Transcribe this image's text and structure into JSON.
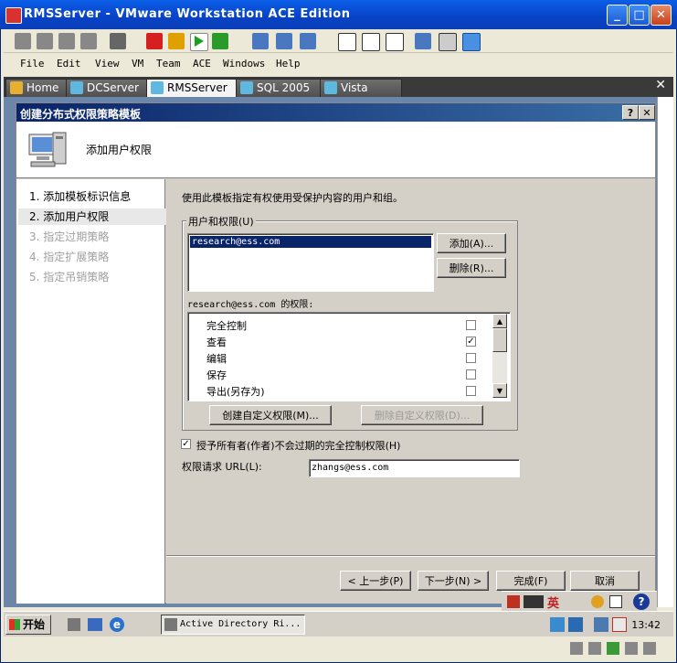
{
  "window": {
    "title": "RMSServer - VMware Workstation ACE Edition"
  },
  "menubar": [
    "File",
    "Edit",
    "View",
    "VM",
    "Team",
    "ACE",
    "Windows",
    "Help"
  ],
  "tabs": [
    {
      "label": "Home",
      "active": false
    },
    {
      "label": "DCServer",
      "active": false
    },
    {
      "label": "RMSServer",
      "active": true
    },
    {
      "label": "SQL 2005",
      "active": false
    },
    {
      "label": "Vista",
      "active": false
    }
  ],
  "dialog": {
    "title": "创建分布式权限策略模板",
    "header": "添加用户权限",
    "steps": [
      {
        "label": "1. 添加模板标识信息",
        "state": "done"
      },
      {
        "label": "2. 添加用户权限",
        "state": "current"
      },
      {
        "label": "3. 指定过期策略",
        "state": "disabled"
      },
      {
        "label": "4. 指定扩展策略",
        "state": "disabled"
      },
      {
        "label": "5. 指定吊销策略",
        "state": "disabled"
      }
    ],
    "intro": "使用此模板指定有权使用受保护内容的用户和组。",
    "users_group_label": "用户和权限(U)",
    "users": [
      "research@ess.com"
    ],
    "add_button": "添加(A)...",
    "remove_button": "删除(R)...",
    "perms_label": "research@ess.com 的权限:",
    "permissions": [
      {
        "label": "完全控制",
        "checked": false
      },
      {
        "label": "查看",
        "checked": true
      },
      {
        "label": "编辑",
        "checked": false
      },
      {
        "label": "保存",
        "checked": false
      },
      {
        "label": "导出(另存为)",
        "checked": false
      }
    ],
    "create_custom_button": "创建自定义权限(M)...",
    "delete_custom_button": "删除自定义权限(D)...",
    "grant_owner_checked": true,
    "grant_owner_label": "授予所有者(作者)不会过期的完全控制权限(H)",
    "url_label": "权限请求 URL(L):",
    "url_value": "zhangs@ess.com",
    "prev_button": "< 上一步(P)",
    "next_button": "下一步(N) >",
    "finish_button": "完成(F)",
    "cancel_button": "取消"
  },
  "ime": {
    "lang": "英"
  },
  "taskbar": {
    "start": "开始",
    "item": "Active Directory Ri...",
    "clock": "13:42"
  },
  "colors": {
    "titlebar": "#0842c6",
    "dialog_title": "#0a246a",
    "selection": "#0a246a"
  }
}
